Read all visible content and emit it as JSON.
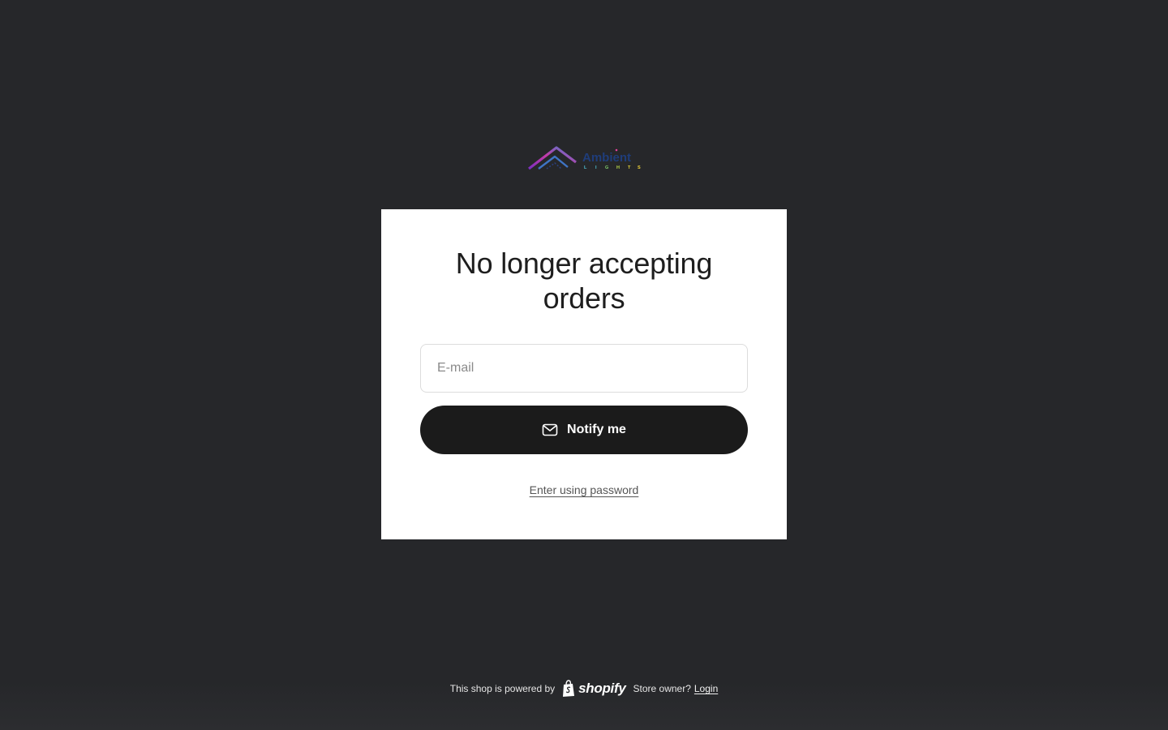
{
  "logo": {
    "name": "Ambient Lights logo",
    "icon": "house-roof-logo-icon",
    "brand_colors": [
      "#7b2fbf",
      "#e0409a",
      "#2f5fa8",
      "#4ec3d6",
      "#f2d43a"
    ]
  },
  "card": {
    "title": "No longer accepting orders",
    "email": {
      "placeholder": "E-mail",
      "value": ""
    },
    "notify_button": {
      "label": "Notify me",
      "icon": "envelope-icon"
    },
    "password_link": "Enter using password"
  },
  "footer": {
    "powered_text": "This shop is powered by",
    "shopify_icon": "shopify-bag-icon",
    "shopify_word": "shopify",
    "owner_text": "Store owner?",
    "login_label": "Login"
  },
  "colors": {
    "background": "#26272a",
    "card": "#ffffff",
    "button": "#1b1b1b",
    "text": "#1e1e1e"
  }
}
